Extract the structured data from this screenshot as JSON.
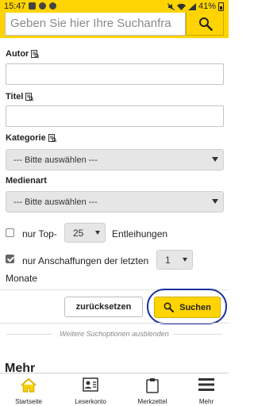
{
  "status_bar": {
    "time": "15:47",
    "battery": "41%"
  },
  "search": {
    "placeholder": "Geben Sie hier Ihre Suchanfra"
  },
  "form": {
    "author_label": "Autor",
    "title_label": "Titel",
    "category_label": "Kategorie",
    "category_value": "--- Bitte auswählen ---",
    "media_label": "Medienart",
    "media_value": "--- Bitte auswählen ---",
    "top_prefix": "nur Top-",
    "top_value": "25",
    "top_suffix": "Entleihungen",
    "acq_label": "nur Anschaffungen der letzten",
    "acq_value": "1",
    "acq_unit": "Monate"
  },
  "buttons": {
    "reset": "zurücksetzen",
    "search": "Suchen"
  },
  "more_options_link": "Weitere Suchoptionen ausblenden",
  "section_heading": "Mehr",
  "tabs": [
    {
      "label": "Startseite",
      "icon": "home-icon"
    },
    {
      "label": "Leserkonto",
      "icon": "account-icon"
    },
    {
      "label": "Merkzettel",
      "icon": "clipboard-icon"
    },
    {
      "label": "Mehr",
      "icon": "menu-icon"
    }
  ],
  "colors": {
    "accent": "#ffd400",
    "highlight_ring": "#1a2fa0"
  }
}
